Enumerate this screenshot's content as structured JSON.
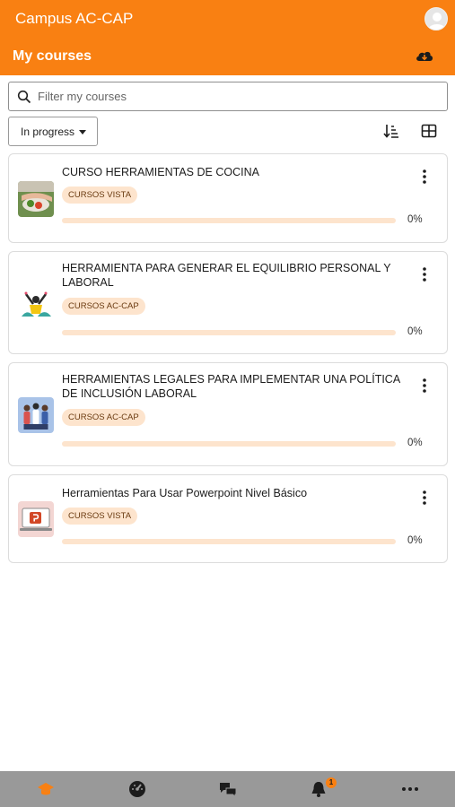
{
  "app": {
    "title": "Campus AC-CAP"
  },
  "header": {
    "page_title": "My courses"
  },
  "search": {
    "placeholder": "Filter my courses",
    "value": ""
  },
  "filter": {
    "selected": "In progress"
  },
  "courses": [
    {
      "name": "CURSO HERRAMIENTAS DE COCINA",
      "category": "CURSOS VISTA",
      "progress": 0,
      "progress_label": "0%",
      "thumbnail": "cooking-photo"
    },
    {
      "name": "HERRAMIENTA PARA GENERAR EL EQUILIBRIO PERSONAL Y LABORAL",
      "category": "CURSOS AC-CAP",
      "progress": 0,
      "progress_label": "0%",
      "thumbnail": "celebrating-person-illustration"
    },
    {
      "name": "HERRAMIENTAS LEGALES PARA IMPLEMENTAR UNA POLÍTICA DE INCLUSIÓN LABORAL",
      "category": "CURSOS AC-CAP",
      "progress": 0,
      "progress_label": "0%",
      "thumbnail": "group-of-people-illustration"
    },
    {
      "name": "Herramientas Para Usar Powerpoint Nivel Básico",
      "category": "CURSOS VISTA",
      "progress": 0,
      "progress_label": "0%",
      "thumbnail": "powerpoint-laptop-illustration"
    }
  ],
  "tabbar": {
    "items": [
      "my-courses-icon",
      "dashboard-icon",
      "messages-icon",
      "notifications-icon",
      "more-icon"
    ],
    "notifications_badge": "1"
  },
  "colors": {
    "brand": "#f98012",
    "category_bg": "#fde4cd",
    "tabbar_bg": "#999999"
  }
}
